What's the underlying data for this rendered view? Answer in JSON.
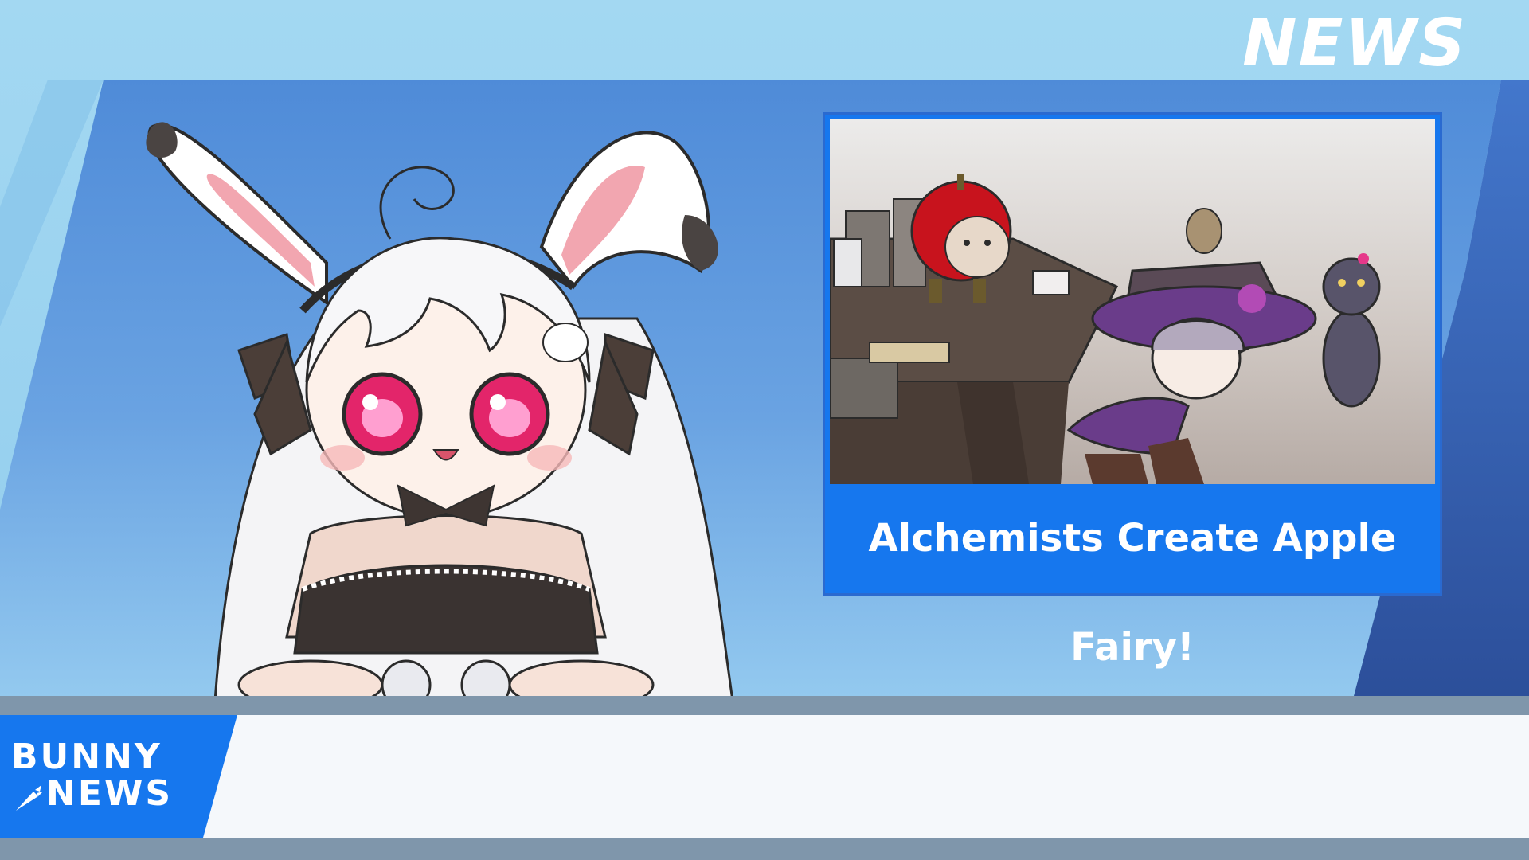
{
  "top_logo": {
    "text": "NEWS"
  },
  "inset": {
    "headline": "Alchemists Create Apple Fairy!"
  },
  "ticker": {
    "text": ""
  },
  "brand": {
    "line1": "BUNNY",
    "line2": "NEWS"
  },
  "colors": {
    "sky": "#9cd3ef",
    "panel_blue": "#4b8ad6",
    "panel_dark": "#2f5fae",
    "headline_bg": "#1677ee",
    "desk": "#7f96ab",
    "ticker_bg": "#f5f8fb",
    "brand_bg": "#1677ee"
  }
}
